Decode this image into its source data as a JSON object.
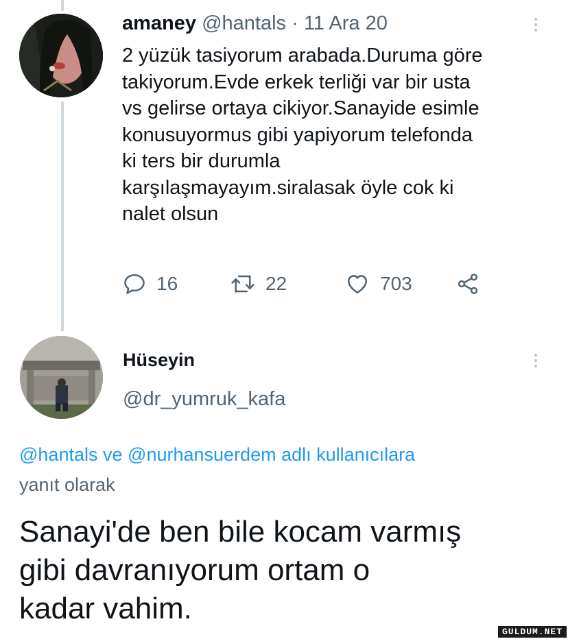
{
  "tweet1": {
    "name": "amaney",
    "handle": "@hantals",
    "separator": "·",
    "date": "11 Ara 20",
    "text": "2 yüzük tasiyorum arabada.Duruma göre\ntakiyorum.Evde erkek terliği var bir usta\nvs gelirse ortaya cikiyor.Sanayide esimle\nkonusuyormus gibi yapiyorum telefonda\nki ters bir durumla\nkarşılaşmayayım.siralasak öyle cok ki\nnalet olsun",
    "replies": "16",
    "retweets": "22",
    "likes": "703"
  },
  "tweet2": {
    "name": "Hüseyin",
    "handle": "@dr_yumruk_kafa",
    "reply_to_1": "@hantals",
    "reply_to_and": "ve",
    "reply_to_2": "@nurhansuerdem",
    "reply_to_suffix": "adlı kullanıcılara",
    "reply_label": "yanıt olarak",
    "text": "Sanayi'de ben bile kocam varmış\ngibi davranıyorum ortam o\nkadar vahim."
  },
  "watermark": "GULDUM.NET",
  "icons": {
    "reply": "speech-bubble-icon",
    "retweet": "retweet-icon",
    "like": "heart-icon",
    "share": "share-icon",
    "more": "vertical-dots-icon"
  },
  "colors": {
    "link": "#1d9bf0",
    "secondary": "#536471",
    "text": "#0f1419"
  }
}
